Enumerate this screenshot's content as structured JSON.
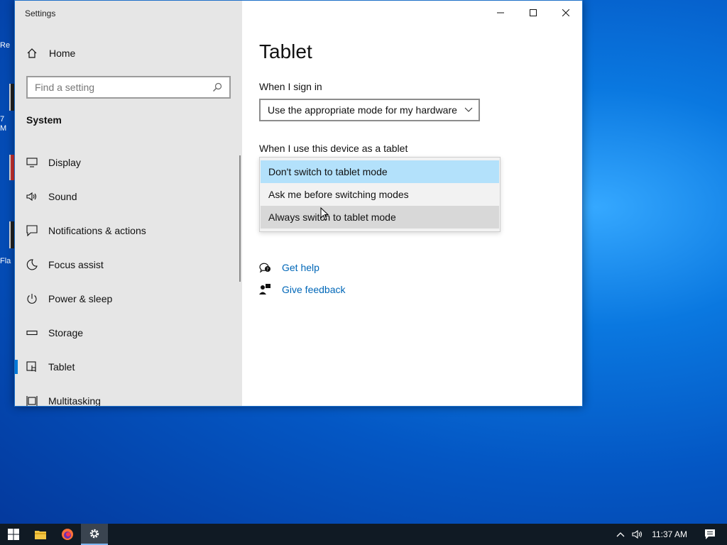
{
  "desktop": {
    "fragments": [
      "Re",
      "7",
      "M",
      "Fla"
    ]
  },
  "window": {
    "title": "Settings",
    "controls": {
      "minimize_icon": "minimize-icon",
      "maximize_icon": "maximize-icon",
      "close_icon": "close-icon"
    }
  },
  "sidebar": {
    "home_label": "Home",
    "search_placeholder": "Find a setting",
    "section_title": "System",
    "items": [
      {
        "label": "Display",
        "icon": "display-icon"
      },
      {
        "label": "Sound",
        "icon": "sound-icon"
      },
      {
        "label": "Notifications & actions",
        "icon": "notifications-icon"
      },
      {
        "label": "Focus assist",
        "icon": "moon-icon"
      },
      {
        "label": "Power & sleep",
        "icon": "power-icon"
      },
      {
        "label": "Storage",
        "icon": "storage-icon"
      },
      {
        "label": "Tablet",
        "icon": "tablet-icon",
        "active": true
      },
      {
        "label": "Multitasking",
        "icon": "multitasking-icon"
      }
    ]
  },
  "main": {
    "title": "Tablet",
    "sign_in_label": "When I sign in",
    "sign_in_value": "Use the appropriate mode for my hardware",
    "tablet_label": "When I use this device as a tablet",
    "tablet_options": [
      {
        "label": "Don't switch to tablet mode",
        "state": "selected"
      },
      {
        "label": "Ask me before switching modes",
        "state": "normal"
      },
      {
        "label": "Always switch to tablet mode",
        "state": "hover"
      }
    ],
    "help_links": [
      {
        "label": "Get help",
        "icon": "help-chat-icon"
      },
      {
        "label": "Give feedback",
        "icon": "feedback-icon"
      }
    ]
  },
  "taskbar": {
    "apps": [
      "windows-start-icon",
      "file-explorer-icon",
      "firefox-icon",
      "settings-gear-icon"
    ],
    "clock": "11:37 AM"
  },
  "colors": {
    "accent": "#0078d7",
    "selected_option": "#b3e1fb",
    "link": "#0067b8"
  }
}
